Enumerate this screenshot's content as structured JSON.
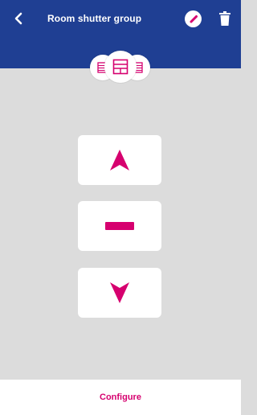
{
  "header": {
    "title": "Room shutter group",
    "back_icon": "chevron-left-icon",
    "edit_icon": "pencil-icon",
    "delete_icon": "trash-icon"
  },
  "group_icons": [
    "shutter-icon",
    "shutter-icon",
    "shutter-icon"
  ],
  "controls": {
    "up_icon": "triangle-up-icon",
    "stop_icon": "minus-bar-icon",
    "down_icon": "triangle-down-icon"
  },
  "footer": {
    "configure_label": "Configure"
  },
  "colors": {
    "header": "#1f3f93",
    "background": "#dcdcdc",
    "accent": "#d6006f",
    "surface": "#ffffff"
  }
}
